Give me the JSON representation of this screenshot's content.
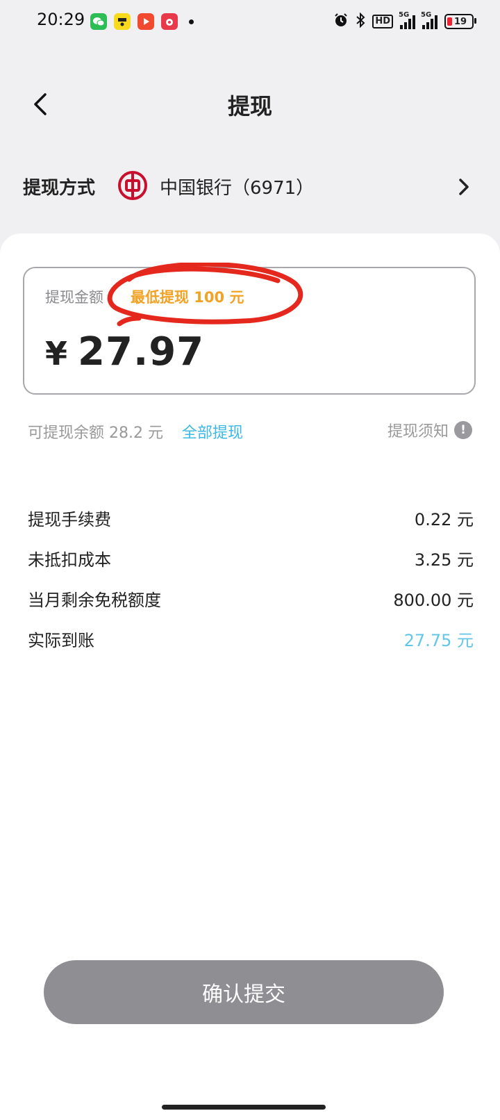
{
  "status_bar": {
    "time": "20:29",
    "icons": [
      "wechat-app-icon",
      "meituan-app-icon",
      "video-app-icon",
      "shopping-app-icon",
      "notification-dot",
      "alarm-icon",
      "bluetooth-icon",
      "hd-icon",
      "signal-5g-icon",
      "signal-5g-icon",
      "battery-icon"
    ],
    "hd": "HD",
    "signal1": "5G",
    "signal2": "5G",
    "battery": "19"
  },
  "header": {
    "title": "提现"
  },
  "method": {
    "label": "提现方式",
    "bank": "中国银行（6971）"
  },
  "amount": {
    "label": "提现金额",
    "min_hint": "最低提现 100 元",
    "currency": "¥",
    "value": "27.97"
  },
  "available": {
    "text": "可提现余额 28.2 元",
    "withdraw_all": "全部提现",
    "notice": "提现须知"
  },
  "fees": [
    {
      "label": "提现手续费",
      "value": "0.22 元"
    },
    {
      "label": "未抵扣成本",
      "value": "3.25 元"
    },
    {
      "label": "当月剩余免税额度",
      "value": "800.00 元"
    },
    {
      "label": "实际到账",
      "value": "27.75 元"
    }
  ],
  "submit_label": "确认提交",
  "colors": {
    "accent": "#3bb8e6",
    "warning": "#f2a224",
    "bank_red": "#c8102e",
    "annotation_red": "#e5281e",
    "button_disabled": "#8e8e93"
  }
}
